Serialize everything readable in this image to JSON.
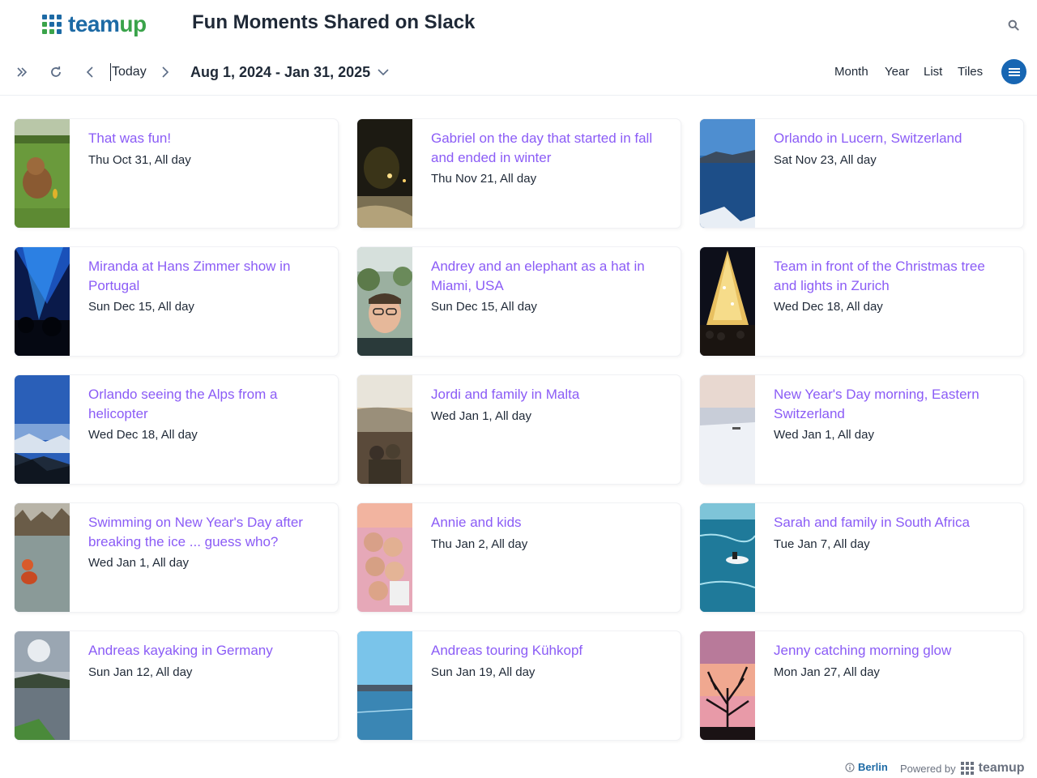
{
  "header": {
    "logo_text_a": "team",
    "logo_text_b": "up",
    "title": "Fun Moments Shared on Slack",
    "search_icon": "search-icon"
  },
  "toolbar": {
    "today_label": "Today",
    "date_range": "Aug 1, 2024 - Jan 31, 2025",
    "views": [
      "Month",
      "Year",
      "List",
      "Tiles"
    ]
  },
  "colors": {
    "title_accent": "#8b5cf6",
    "brand_blue": "#1d6aa5",
    "brand_green": "#3aa34a",
    "menu_button": "#1766b3"
  },
  "events": [
    {
      "title": "That was fun!",
      "date": "Thu Oct 31, All day",
      "photo": "dog-on-grass"
    },
    {
      "title": "Gabriel on the day that started in fall and ended in winter",
      "date": "Thu Nov 21, All day",
      "photo": "night-snow-path"
    },
    {
      "title": "Orlando in Lucern, Switzerland",
      "date": "Sat Nov 23, All day",
      "photo": "lake-mountains"
    },
    {
      "title": "Miranda at Hans Zimmer show in Portugal",
      "date": "Sun Dec 15, All day",
      "photo": "concert-blue-lights"
    },
    {
      "title": "Andrey and an elephant as a hat in Miami, USA",
      "date": "Sun Dec 15, All day",
      "photo": "selfie-man-glasses"
    },
    {
      "title": "Team in front of the Christmas tree and lights in Zurich",
      "date": "Wed Dec 18, All day",
      "photo": "christmas-tree"
    },
    {
      "title": "Orlando seeing the Alps from a helicopter",
      "date": "Wed Dec 18, All day",
      "photo": "alps-aerial"
    },
    {
      "title": "Jordi and family in Malta",
      "date": "Wed Jan 1, All day",
      "photo": "coast-sunset"
    },
    {
      "title": "New Year's Day morning, Eastern Switzerland",
      "date": "Wed Jan 1, All day",
      "photo": "snow-field-dawn"
    },
    {
      "title": "Swimming on New Year's Day after breaking the ice ... guess who?",
      "date": "Wed Jan 1, All day",
      "photo": "ice-swim"
    },
    {
      "title": "Annie and kids",
      "date": "Thu Jan 2, All day",
      "photo": "family-selfie"
    },
    {
      "title": "Sarah and family in South Africa",
      "date": "Tue Jan 7, All day",
      "photo": "jetski-ocean"
    },
    {
      "title": "Andreas kayaking in Germany",
      "date": "Sun Jan 12, All day",
      "photo": "kayak-lake"
    },
    {
      "title": "Andreas touring Kühkopf",
      "date": "Sun Jan 19, All day",
      "photo": "river-sky"
    },
    {
      "title": "Jenny catching morning glow",
      "date": "Mon Jan 27, All day",
      "photo": "tree-pink-sky"
    }
  ],
  "footer": {
    "timezone": "Berlin",
    "powered_by": "Powered by",
    "brand": "teamup"
  }
}
